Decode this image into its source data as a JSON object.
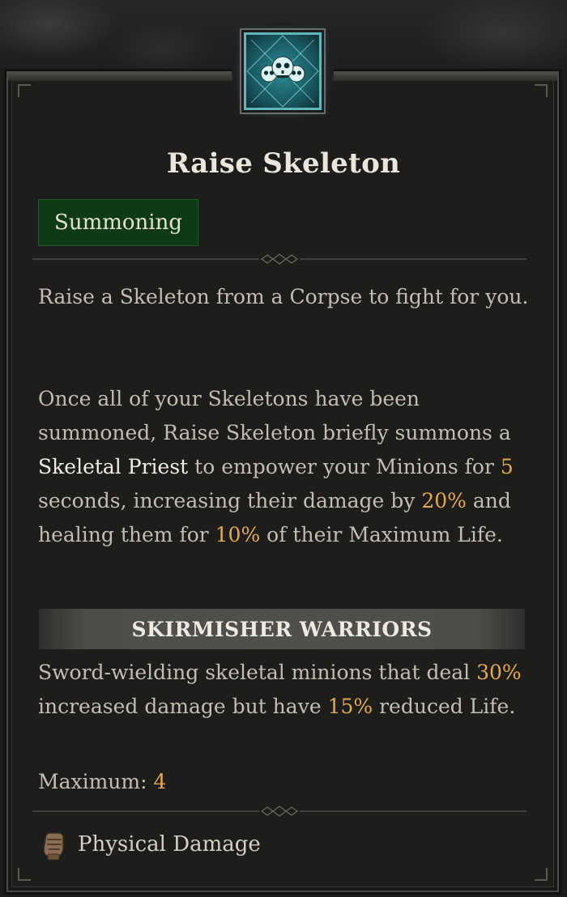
{
  "skill": {
    "name": "Raise Skeleton",
    "icon": "skull-icon",
    "tag": "Summoning",
    "description_1": "Raise a Skeleton from a Corpse to fight for you.",
    "description_2": {
      "t1": "Once all of your Skeletons have been summoned, Raise Skeleton briefly summons a ",
      "t2": "Skeletal Priest",
      "t3": " to empower your Minions for ",
      "t4": "5",
      "t5": " seconds, increasing their damage by ",
      "t6": "20%",
      "t7": " and healing them for ",
      "t8": "10%",
      "t9": " of their Maximum Life."
    }
  },
  "variant": {
    "title": "SKIRMISHER WARRIORS",
    "t1": "Sword-wielding skeletal minions that deal ",
    "t2": "30%",
    "t3": " increased damage but have ",
    "t4": "15%",
    "t5": " reduced Life.",
    "max_label": "Maximum: ",
    "max_value": "4"
  },
  "damage": {
    "icon": "fist-icon",
    "type": "Physical Damage"
  },
  "colors": {
    "highlight": "#e6a94a",
    "tag_bg": "#0f3a17",
    "icon_teal": "#2c8e96"
  }
}
